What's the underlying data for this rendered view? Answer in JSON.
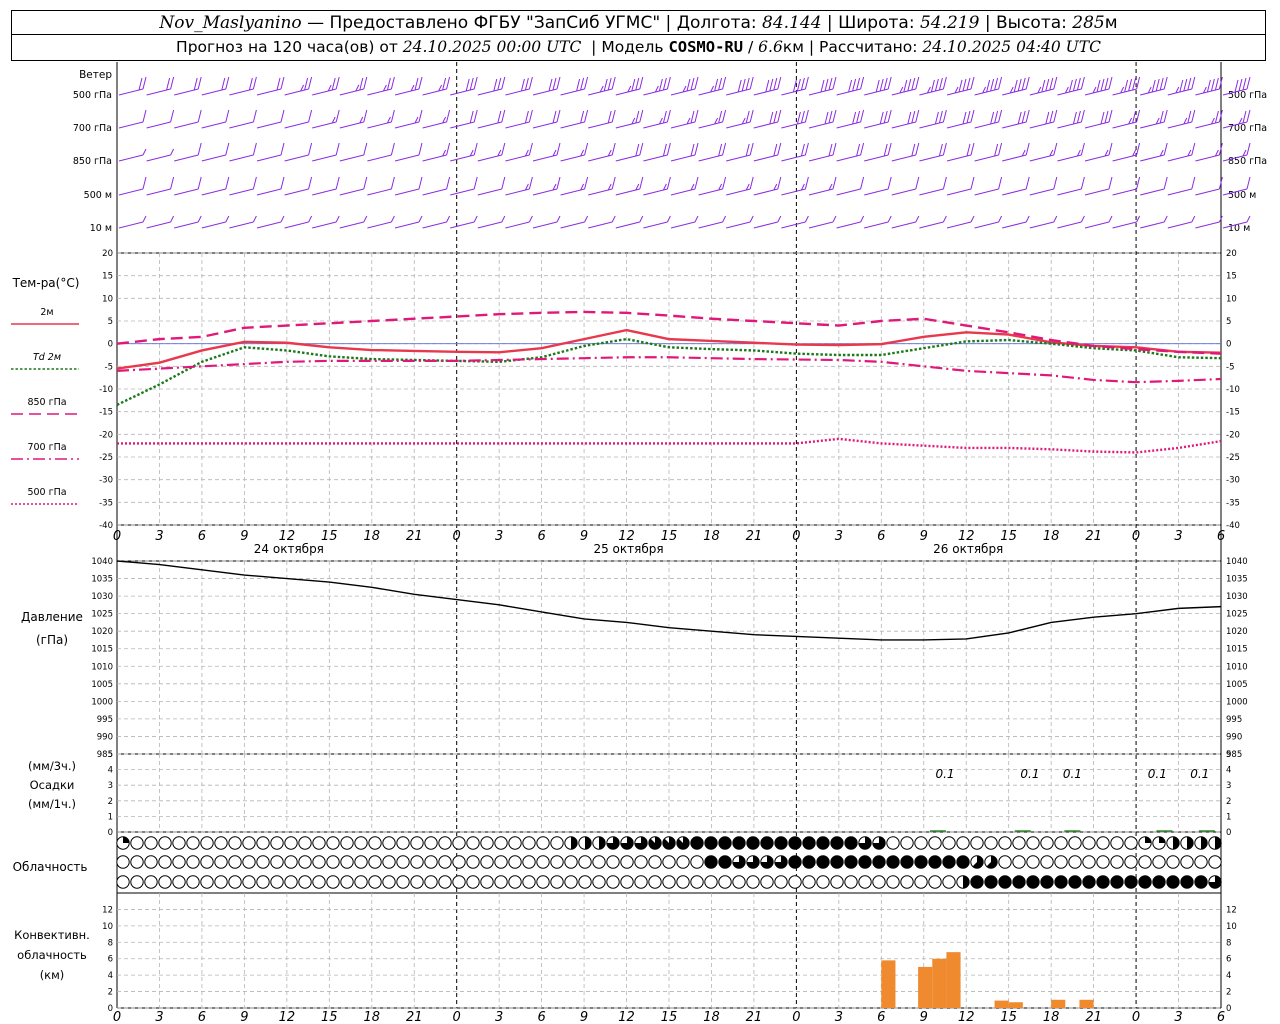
{
  "header": {
    "station": "Nov_Maslyanino",
    "provider": "— Предоставлено ФГБУ \"ЗапСиб УГМС\"",
    "lon_label": "Долгота:",
    "lon_value": "84.144",
    "lat_label": "Широта:",
    "lat_value": "54.219",
    "alt_label": "Высота:",
    "alt_value": "285",
    "alt_unit": "м",
    "forecast_label": "Прогноз на 120 часа(ов) от",
    "forecast_start": "24.10.2025 00:00 UTC",
    "model_label": "Модель",
    "model_name": "COSMO-RU",
    "model_res": "6.6",
    "model_res_unit": "км",
    "calc_label": "Рассчитано:",
    "calc_time": "24.10.2025 04:40 UTC"
  },
  "chart_data": [
    {
      "type": "barbs",
      "panel": "wind",
      "title": "Ветер",
      "levels": [
        "500 гПа",
        "700 гПа",
        "850 гПа",
        "500 м",
        "10 м"
      ],
      "barb_color": "#8b2be2",
      "speed_ms": {
        "500 гПа": [
          18,
          20,
          20,
          20,
          22,
          22,
          24,
          25,
          25,
          26,
          26,
          27,
          28,
          30,
          30,
          32,
          32,
          33,
          34,
          35,
          36,
          36,
          38,
          40,
          40,
          42,
          42,
          42,
          44,
          45,
          45,
          45,
          45,
          45,
          45,
          45,
          44,
          44,
          44,
          44,
          42
        ],
        "700 гПа": [
          8,
          8,
          10,
          10,
          10,
          12,
          12,
          14,
          14,
          15,
          15,
          16,
          18,
          18,
          20,
          20,
          22,
          22,
          24,
          25,
          25,
          26,
          26,
          28,
          28,
          28,
          30,
          30,
          30,
          30,
          30,
          30,
          28,
          28,
          28,
          28,
          26,
          26,
          26,
          26,
          25
        ],
        "850 гПа": [
          6,
          6,
          8,
          8,
          8,
          10,
          10,
          10,
          12,
          12,
          12,
          14,
          14,
          14,
          15,
          15,
          16,
          16,
          18,
          18,
          18,
          18,
          18,
          20,
          20,
          20,
          20,
          20,
          18,
          18,
          18,
          18,
          16,
          16,
          16,
          16,
          15,
          15,
          15,
          15,
          14
        ],
        "500 м": [
          8,
          8,
          10,
          10,
          10,
          10,
          10,
          12,
          12,
          12,
          12,
          12,
          12,
          12,
          14,
          14,
          14,
          14,
          14,
          15,
          15,
          15,
          15,
          14,
          14,
          14,
          12,
          12,
          12,
          12,
          10,
          10,
          10,
          10,
          10,
          10,
          10,
          8,
          8,
          8,
          8
        ],
        "10 м": [
          3,
          3,
          4,
          4,
          4,
          4,
          4,
          4,
          4,
          4,
          4,
          4,
          4,
          5,
          5,
          5,
          5,
          5,
          5,
          5,
          5,
          5,
          5,
          5,
          5,
          5,
          4,
          4,
          4,
          4,
          4,
          4,
          4,
          3,
          3,
          3,
          3,
          3,
          3,
          3,
          3
        ]
      }
    },
    {
      "type": "line",
      "panel": "temperature",
      "ylabel": "Тем-ра(°C)",
      "ylim": [
        -40,
        20
      ],
      "yticks": [
        20,
        15,
        10,
        5,
        0,
        -5,
        -10,
        -15,
        -20,
        -25,
        -30,
        -35,
        -40
      ],
      "x": [
        0,
        3,
        6,
        9,
        12,
        15,
        18,
        21,
        24,
        27,
        30,
        33,
        36,
        39,
        42,
        45,
        48,
        51,
        54,
        57,
        60,
        63,
        66,
        69,
        72,
        75,
        78
      ],
      "series": [
        {
          "name": "2м",
          "color": "#e8384c",
          "dash": "solid",
          "values": [
            -5.5,
            -4.2,
            -1.5,
            0.4,
            0.2,
            -0.8,
            -1.4,
            -1.6,
            -1.8,
            -1.9,
            -1.0,
            1.0,
            3.0,
            1.0,
            0.6,
            0.2,
            -0.2,
            -0.3,
            -0.1,
            1.5,
            2.5,
            2.0,
            0.3,
            -0.5,
            -0.8,
            -1.8,
            -2.0
          ]
        },
        {
          "name": "Td 2м",
          "color": "#1a7a1a",
          "dash": "dot",
          "values": [
            -13.5,
            -9.0,
            -4.0,
            -0.8,
            -1.5,
            -2.8,
            -3.4,
            -3.6,
            -3.8,
            -4.0,
            -3.0,
            -0.5,
            1.0,
            -0.8,
            -1.2,
            -1.5,
            -2.2,
            -2.5,
            -2.5,
            -1.0,
            0.5,
            0.8,
            0.0,
            -1.0,
            -1.5,
            -3.0,
            -3.2
          ]
        },
        {
          "name": "850 гПа",
          "color": "#e0187a",
          "dash": "long",
          "values": [
            0.0,
            1.0,
            1.5,
            3.5,
            4.0,
            4.5,
            5.0,
            5.5,
            6.0,
            6.5,
            6.8,
            7.0,
            6.8,
            6.2,
            5.5,
            5.0,
            4.5,
            4.0,
            5.0,
            5.5,
            4.0,
            2.5,
            0.8,
            -0.5,
            -1.2,
            -1.8,
            -2.2
          ]
        },
        {
          "name": "700 гПа",
          "color": "#e0187a",
          "dash": "dashdot",
          "values": [
            -6.0,
            -5.5,
            -5.0,
            -4.5,
            -4.0,
            -3.8,
            -3.8,
            -3.8,
            -3.8,
            -3.6,
            -3.4,
            -3.2,
            -3.0,
            -3.0,
            -3.2,
            -3.4,
            -3.5,
            -3.6,
            -4.0,
            -5.0,
            -6.0,
            -6.5,
            -7.0,
            -8.0,
            -8.5,
            -8.2,
            -7.8
          ]
        },
        {
          "name": "500 гПа",
          "color": "#e0187a",
          "dash": "fine",
          "values": [
            -22.0,
            -22.0,
            -22.0,
            -22.0,
            -22.0,
            -22.0,
            -22.0,
            -22.0,
            -22.0,
            -22.0,
            -22.0,
            -22.0,
            -22.0,
            -22.0,
            -22.0,
            -22.0,
            -22.0,
            -21.0,
            -22.0,
            -22.5,
            -23.0,
            -23.0,
            -23.3,
            -23.8,
            -24.0,
            -23.0,
            -21.5
          ]
        }
      ]
    },
    {
      "type": "line",
      "panel": "pressure",
      "ylabel": "Давление",
      "yunit": "(гПа)",
      "ylim": [
        985,
        1040
      ],
      "yticks": [
        1040,
        1035,
        1030,
        1025,
        1020,
        1015,
        1010,
        1005,
        1000,
        995,
        990,
        985
      ],
      "x": [
        0,
        3,
        6,
        9,
        12,
        15,
        18,
        21,
        24,
        27,
        30,
        33,
        36,
        39,
        42,
        45,
        48,
        51,
        54,
        57,
        60,
        63,
        66,
        69,
        72,
        75,
        78
      ],
      "series": [
        {
          "color": "#000000",
          "values": [
            1040.0,
            1039.0,
            1037.5,
            1036.0,
            1035.0,
            1034.0,
            1032.5,
            1030.5,
            1029.0,
            1027.5,
            1025.5,
            1023.5,
            1022.5,
            1021.0,
            1020.0,
            1019.0,
            1018.5,
            1018.0,
            1017.5,
            1017.5,
            1017.8,
            1019.5,
            1022.5,
            1024.0,
            1025.0,
            1026.5,
            1027.0
          ]
        }
      ]
    },
    {
      "type": "bar",
      "panel": "precipitation",
      "ylabel_top": "(мм/3ч.)",
      "ylabel": "Осадки",
      "ylabel_bottom": "(мм/1ч.)",
      "ylim": [
        0,
        5
      ],
      "yticks": [
        5,
        4,
        3,
        2,
        1,
        0
      ],
      "labels": [
        {
          "x": 58.5,
          "text": "0.1"
        },
        {
          "x": 64.5,
          "text": "0.1"
        },
        {
          "x": 67.5,
          "text": "0.1"
        },
        {
          "x": 73.5,
          "text": "0.1"
        },
        {
          "x": 76.5,
          "text": "0.1"
        }
      ],
      "bars": [
        {
          "x": 58.0,
          "value": 0.05
        },
        {
          "x": 64.0,
          "value": 0.05
        },
        {
          "x": 67.5,
          "value": 0.05
        },
        {
          "x": 74.0,
          "value": 0.05
        },
        {
          "x": 77.0,
          "value": 0.05
        }
      ]
    },
    {
      "type": "heatmap",
      "panel": "cloudiness",
      "ylabel": "Облачность",
      "rows": [
        "upper",
        "middle",
        "lower"
      ],
      "oktas": {
        "upper": [
          2,
          0,
          0,
          0,
          0,
          0,
          0,
          0,
          0,
          0,
          0,
          0,
          0,
          0,
          0,
          0,
          0,
          0,
          0,
          0,
          0,
          0,
          0,
          0,
          0,
          0,
          0,
          0,
          0,
          0,
          0,
          0,
          0,
          0,
          0,
          0,
          0,
          0,
          0,
          0,
          0,
          0,
          0,
          0,
          0,
          0,
          0,
          0,
          0,
          0,
          0,
          0,
          0,
          0,
          0,
          0,
          0,
          0,
          0,
          0,
          0,
          0,
          0,
          0,
          0,
          0,
          0,
          0,
          0,
          0,
          0,
          0,
          0,
          0,
          0,
          0,
          0,
          0,
          0
        ],
        "middle": [
          0,
          0,
          0,
          0,
          0,
          0,
          0,
          0,
          0,
          0,
          0,
          0,
          0,
          0,
          0,
          0,
          0,
          0,
          0,
          0,
          0,
          0,
          0,
          0,
          0,
          0,
          0,
          0,
          0,
          0,
          0,
          0,
          0,
          0,
          0,
          0,
          0,
          0,
          0,
          0,
          0,
          0,
          0,
          0,
          0,
          0,
          0,
          0,
          0,
          0,
          0,
          0,
          0,
          0,
          0,
          0,
          0,
          0,
          0,
          0,
          0,
          0,
          0,
          0,
          0,
          0,
          0,
          0,
          0,
          0,
          0,
          0,
          0,
          0,
          0,
          0,
          0,
          0,
          0
        ],
        "lower": [
          0,
          0,
          0,
          0,
          0,
          0,
          0,
          0,
          0,
          0,
          0,
          0,
          0,
          0,
          0,
          0,
          0,
          0,
          0,
          0,
          0,
          0,
          0,
          0,
          0,
          0,
          0,
          0,
          0,
          0,
          0,
          0,
          0,
          0,
          0,
          0,
          0,
          0,
          0,
          0,
          0,
          0,
          0,
          0,
          0,
          0,
          0,
          0,
          0,
          0,
          0,
          0,
          0,
          0,
          0,
          0,
          0,
          0,
          0,
          0,
          0,
          0,
          0,
          0,
          0,
          0,
          0,
          0,
          0,
          0,
          0,
          0,
          0,
          0,
          0,
          0,
          0,
          0,
          0
        ]
      },
      "oktas_spans": {
        "upper": [
          [
            32,
            34,
            4
          ],
          [
            35,
            37,
            6
          ],
          [
            38,
            40,
            7
          ],
          [
            41,
            48,
            8
          ],
          [
            49,
            52,
            8
          ],
          [
            53,
            54,
            6
          ],
          [
            73,
            74,
            2
          ],
          [
            75,
            78,
            4
          ]
        ],
        "middle": [
          [
            42,
            43,
            8
          ],
          [
            44,
            47,
            6
          ],
          [
            48,
            57,
            8
          ],
          [
            58,
            60,
            8
          ],
          [
            61,
            62,
            5
          ]
        ],
        "lower": [
          [
            60,
            60,
            4
          ],
          [
            61,
            77,
            8
          ],
          [
            78,
            78,
            6
          ]
        ]
      }
    },
    {
      "type": "bar",
      "panel": "convective",
      "ylabel": "Конвективн.",
      "ylabel2": "облачность",
      "yunit": "(км)",
      "ylim": [
        0,
        14
      ],
      "yticks": [
        12,
        10,
        8,
        6,
        4,
        2,
        0
      ],
      "color": "#ef8a2f",
      "bars": [
        {
          "x": 54.0,
          "x2": 55.0,
          "value": 5.8
        },
        {
          "x": 56.6,
          "x2": 57.6,
          "value": 5.0
        },
        {
          "x": 57.6,
          "x2": 58.6,
          "value": 6.0
        },
        {
          "x": 58.6,
          "x2": 59.6,
          "value": 6.8
        },
        {
          "x": 62.0,
          "x2": 63.0,
          "value": 0.9
        },
        {
          "x": 63.0,
          "x2": 64.0,
          "value": 0.7
        },
        {
          "x": 66.0,
          "x2": 67.0,
          "value": 1.0
        },
        {
          "x": 68.0,
          "x2": 69.0,
          "value": 1.0
        }
      ]
    }
  ],
  "time_axis": {
    "hours": [
      0,
      3,
      6,
      9,
      12,
      15,
      18,
      21,
      0,
      3,
      6,
      9,
      12,
      15,
      18,
      21,
      0,
      3,
      6,
      9,
      12,
      15,
      18,
      21,
      0,
      3,
      6
    ],
    "dates": [
      "24 октября",
      "25 октября",
      "26 октября"
    ]
  }
}
